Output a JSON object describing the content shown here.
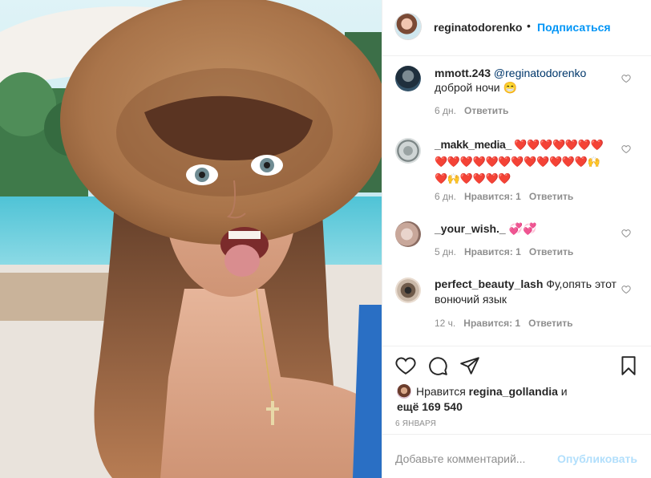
{
  "header": {
    "username": "reginatodorenko",
    "separator": "•",
    "follow_label": "Подписаться"
  },
  "comments": [
    {
      "username": "mmott.243",
      "mention": "@reginatodorenko",
      "text": " доброй ночи 😁",
      "time": "6 дн.",
      "likes": "",
      "reply": "Ответить"
    },
    {
      "username": "_makk_media_",
      "mention": "",
      "text": " ❤️❤️❤️❤️❤️❤️❤️❤️❤️❤️❤️❤️❤️❤️❤️❤️❤️❤️❤️🙌❤️🙌❤️❤️❤️❤️",
      "time": "6 дн.",
      "likes": "Нравится: 1",
      "reply": "Ответить"
    },
    {
      "username": "_your_wish._",
      "mention": "",
      "text": " 💞💞",
      "time": "5 дн.",
      "likes": "Нравится: 1",
      "reply": "Ответить"
    },
    {
      "username": "perfect_beauty_lash",
      "mention": "",
      "text": " Фу,опять этот вонючий язык",
      "time": "12 ч.",
      "likes": "Нравится: 1",
      "reply": "Ответить"
    }
  ],
  "actions": {
    "icons": [
      "heart-icon",
      "comment-icon",
      "share-icon",
      "bookmark-icon"
    ]
  },
  "likes": {
    "prefix": "Нравится ",
    "user": "regina_gollandia",
    "joiner": " и",
    "more": "ещё 169 540"
  },
  "date": "6 ЯНВАРЯ",
  "add_comment": {
    "placeholder": "Добавьте комментарий...",
    "post_label": "Опубликовать"
  },
  "colors": {
    "accent": "#0095f6",
    "post_disabled": "#b2dffc",
    "meta": "#8e8e8e",
    "text": "#262626"
  }
}
